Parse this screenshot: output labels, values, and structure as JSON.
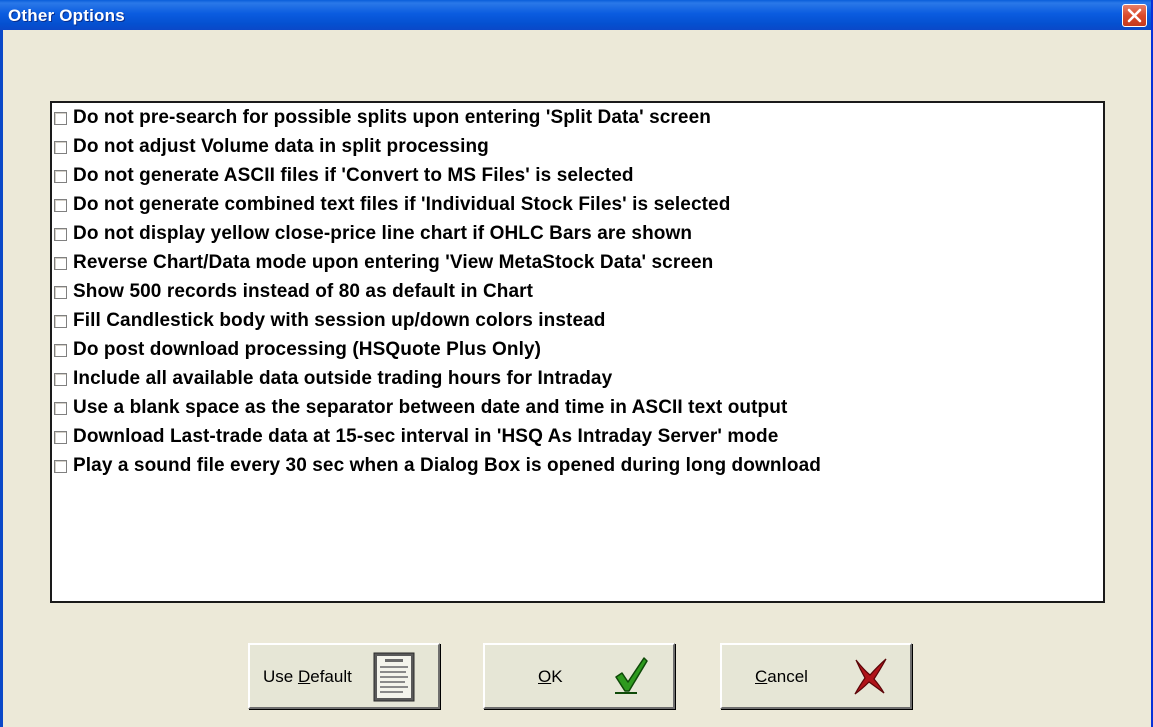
{
  "window": {
    "title": "Other Options"
  },
  "options": [
    {
      "label": "Do not pre-search for possible splits upon entering 'Split Data' screen",
      "checked": false
    },
    {
      "label": "Do not adjust Volume data in split processing",
      "checked": false
    },
    {
      "label": "Do not generate ASCII files if 'Convert to MS Files' is selected",
      "checked": false
    },
    {
      "label": "Do not generate combined text files if 'Individual Stock Files' is selected",
      "checked": false
    },
    {
      "label": "Do not display yellow close-price line chart if OHLC Bars are shown",
      "checked": false
    },
    {
      "label": "Reverse Chart/Data mode upon entering 'View MetaStock Data' screen",
      "checked": false
    },
    {
      "label": "Show 500 records instead of 80 as default in Chart",
      "checked": false
    },
    {
      "label": "Fill Candlestick body with session up/down colors instead",
      "checked": false
    },
    {
      "label": "Do post download processing (HSQuote Plus Only)",
      "checked": false
    },
    {
      "label": "Include all available data outside trading hours for Intraday",
      "checked": false
    },
    {
      "label": "Use a blank space as the separator between date and time in ASCII text output",
      "checked": false
    },
    {
      "label": "Download Last-trade data at 15-sec interval in 'HSQ As Intraday Server' mode",
      "checked": false
    },
    {
      "label": "Play a sound file every 30 sec when a Dialog Box is opened during long download",
      "checked": false
    }
  ],
  "buttons": {
    "default": {
      "label_prefix": "Use ",
      "label_mnemonic": "D",
      "label_suffix": "efault",
      "icon": "document-icon"
    },
    "ok": {
      "label_mnemonic": "O",
      "label_suffix": "K",
      "icon": "checkmark-icon"
    },
    "cancel": {
      "label_mnemonic": "C",
      "label_suffix": "ancel",
      "icon": "x-mark-icon"
    }
  },
  "colors": {
    "titlebar": "#0A5DD9",
    "dialog_bg": "#ECE9D8",
    "close_button": "#DA4A2A",
    "check_green": "#2E9A1E",
    "cancel_red": "#B0141A"
  }
}
